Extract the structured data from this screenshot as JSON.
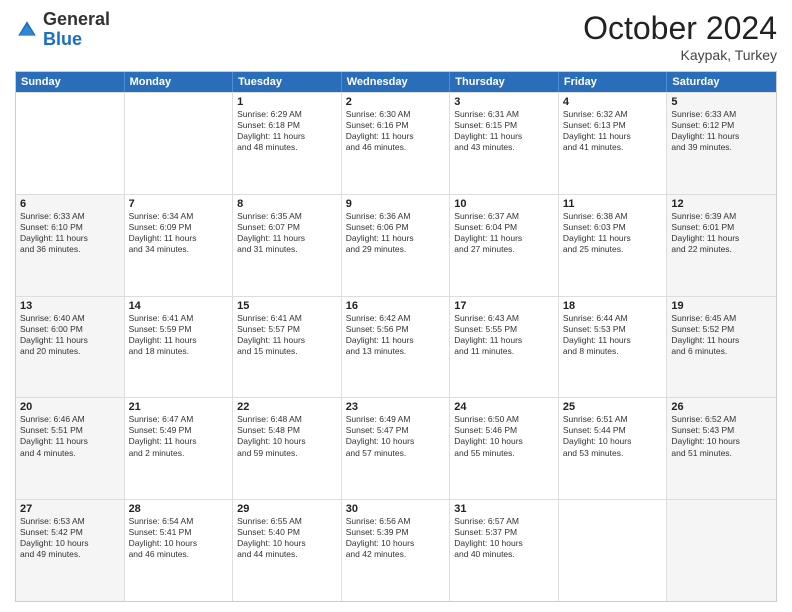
{
  "header": {
    "logo_general": "General",
    "logo_blue": "Blue",
    "month_title": "October 2024",
    "location": "Kaypak, Turkey"
  },
  "weekdays": [
    "Sunday",
    "Monday",
    "Tuesday",
    "Wednesday",
    "Thursday",
    "Friday",
    "Saturday"
  ],
  "rows": [
    [
      {
        "day": "",
        "lines": [],
        "shaded": false
      },
      {
        "day": "",
        "lines": [],
        "shaded": false
      },
      {
        "day": "1",
        "lines": [
          "Sunrise: 6:29 AM",
          "Sunset: 6:18 PM",
          "Daylight: 11 hours",
          "and 48 minutes."
        ],
        "shaded": false
      },
      {
        "day": "2",
        "lines": [
          "Sunrise: 6:30 AM",
          "Sunset: 6:16 PM",
          "Daylight: 11 hours",
          "and 46 minutes."
        ],
        "shaded": false
      },
      {
        "day": "3",
        "lines": [
          "Sunrise: 6:31 AM",
          "Sunset: 6:15 PM",
          "Daylight: 11 hours",
          "and 43 minutes."
        ],
        "shaded": false
      },
      {
        "day": "4",
        "lines": [
          "Sunrise: 6:32 AM",
          "Sunset: 6:13 PM",
          "Daylight: 11 hours",
          "and 41 minutes."
        ],
        "shaded": false
      },
      {
        "day": "5",
        "lines": [
          "Sunrise: 6:33 AM",
          "Sunset: 6:12 PM",
          "Daylight: 11 hours",
          "and 39 minutes."
        ],
        "shaded": true
      }
    ],
    [
      {
        "day": "6",
        "lines": [
          "Sunrise: 6:33 AM",
          "Sunset: 6:10 PM",
          "Daylight: 11 hours",
          "and 36 minutes."
        ],
        "shaded": true
      },
      {
        "day": "7",
        "lines": [
          "Sunrise: 6:34 AM",
          "Sunset: 6:09 PM",
          "Daylight: 11 hours",
          "and 34 minutes."
        ],
        "shaded": false
      },
      {
        "day": "8",
        "lines": [
          "Sunrise: 6:35 AM",
          "Sunset: 6:07 PM",
          "Daylight: 11 hours",
          "and 31 minutes."
        ],
        "shaded": false
      },
      {
        "day": "9",
        "lines": [
          "Sunrise: 6:36 AM",
          "Sunset: 6:06 PM",
          "Daylight: 11 hours",
          "and 29 minutes."
        ],
        "shaded": false
      },
      {
        "day": "10",
        "lines": [
          "Sunrise: 6:37 AM",
          "Sunset: 6:04 PM",
          "Daylight: 11 hours",
          "and 27 minutes."
        ],
        "shaded": false
      },
      {
        "day": "11",
        "lines": [
          "Sunrise: 6:38 AM",
          "Sunset: 6:03 PM",
          "Daylight: 11 hours",
          "and 25 minutes."
        ],
        "shaded": false
      },
      {
        "day": "12",
        "lines": [
          "Sunrise: 6:39 AM",
          "Sunset: 6:01 PM",
          "Daylight: 11 hours",
          "and 22 minutes."
        ],
        "shaded": true
      }
    ],
    [
      {
        "day": "13",
        "lines": [
          "Sunrise: 6:40 AM",
          "Sunset: 6:00 PM",
          "Daylight: 11 hours",
          "and 20 minutes."
        ],
        "shaded": true
      },
      {
        "day": "14",
        "lines": [
          "Sunrise: 6:41 AM",
          "Sunset: 5:59 PM",
          "Daylight: 11 hours",
          "and 18 minutes."
        ],
        "shaded": false
      },
      {
        "day": "15",
        "lines": [
          "Sunrise: 6:41 AM",
          "Sunset: 5:57 PM",
          "Daylight: 11 hours",
          "and 15 minutes."
        ],
        "shaded": false
      },
      {
        "day": "16",
        "lines": [
          "Sunrise: 6:42 AM",
          "Sunset: 5:56 PM",
          "Daylight: 11 hours",
          "and 13 minutes."
        ],
        "shaded": false
      },
      {
        "day": "17",
        "lines": [
          "Sunrise: 6:43 AM",
          "Sunset: 5:55 PM",
          "Daylight: 11 hours",
          "and 11 minutes."
        ],
        "shaded": false
      },
      {
        "day": "18",
        "lines": [
          "Sunrise: 6:44 AM",
          "Sunset: 5:53 PM",
          "Daylight: 11 hours",
          "and 8 minutes."
        ],
        "shaded": false
      },
      {
        "day": "19",
        "lines": [
          "Sunrise: 6:45 AM",
          "Sunset: 5:52 PM",
          "Daylight: 11 hours",
          "and 6 minutes."
        ],
        "shaded": true
      }
    ],
    [
      {
        "day": "20",
        "lines": [
          "Sunrise: 6:46 AM",
          "Sunset: 5:51 PM",
          "Daylight: 11 hours",
          "and 4 minutes."
        ],
        "shaded": true
      },
      {
        "day": "21",
        "lines": [
          "Sunrise: 6:47 AM",
          "Sunset: 5:49 PM",
          "Daylight: 11 hours",
          "and 2 minutes."
        ],
        "shaded": false
      },
      {
        "day": "22",
        "lines": [
          "Sunrise: 6:48 AM",
          "Sunset: 5:48 PM",
          "Daylight: 10 hours",
          "and 59 minutes."
        ],
        "shaded": false
      },
      {
        "day": "23",
        "lines": [
          "Sunrise: 6:49 AM",
          "Sunset: 5:47 PM",
          "Daylight: 10 hours",
          "and 57 minutes."
        ],
        "shaded": false
      },
      {
        "day": "24",
        "lines": [
          "Sunrise: 6:50 AM",
          "Sunset: 5:46 PM",
          "Daylight: 10 hours",
          "and 55 minutes."
        ],
        "shaded": false
      },
      {
        "day": "25",
        "lines": [
          "Sunrise: 6:51 AM",
          "Sunset: 5:44 PM",
          "Daylight: 10 hours",
          "and 53 minutes."
        ],
        "shaded": false
      },
      {
        "day": "26",
        "lines": [
          "Sunrise: 6:52 AM",
          "Sunset: 5:43 PM",
          "Daylight: 10 hours",
          "and 51 minutes."
        ],
        "shaded": true
      }
    ],
    [
      {
        "day": "27",
        "lines": [
          "Sunrise: 6:53 AM",
          "Sunset: 5:42 PM",
          "Daylight: 10 hours",
          "and 49 minutes."
        ],
        "shaded": true
      },
      {
        "day": "28",
        "lines": [
          "Sunrise: 6:54 AM",
          "Sunset: 5:41 PM",
          "Daylight: 10 hours",
          "and 46 minutes."
        ],
        "shaded": false
      },
      {
        "day": "29",
        "lines": [
          "Sunrise: 6:55 AM",
          "Sunset: 5:40 PM",
          "Daylight: 10 hours",
          "and 44 minutes."
        ],
        "shaded": false
      },
      {
        "day": "30",
        "lines": [
          "Sunrise: 6:56 AM",
          "Sunset: 5:39 PM",
          "Daylight: 10 hours",
          "and 42 minutes."
        ],
        "shaded": false
      },
      {
        "day": "31",
        "lines": [
          "Sunrise: 6:57 AM",
          "Sunset: 5:37 PM",
          "Daylight: 10 hours",
          "and 40 minutes."
        ],
        "shaded": false
      },
      {
        "day": "",
        "lines": [],
        "shaded": false
      },
      {
        "day": "",
        "lines": [],
        "shaded": true
      }
    ]
  ]
}
